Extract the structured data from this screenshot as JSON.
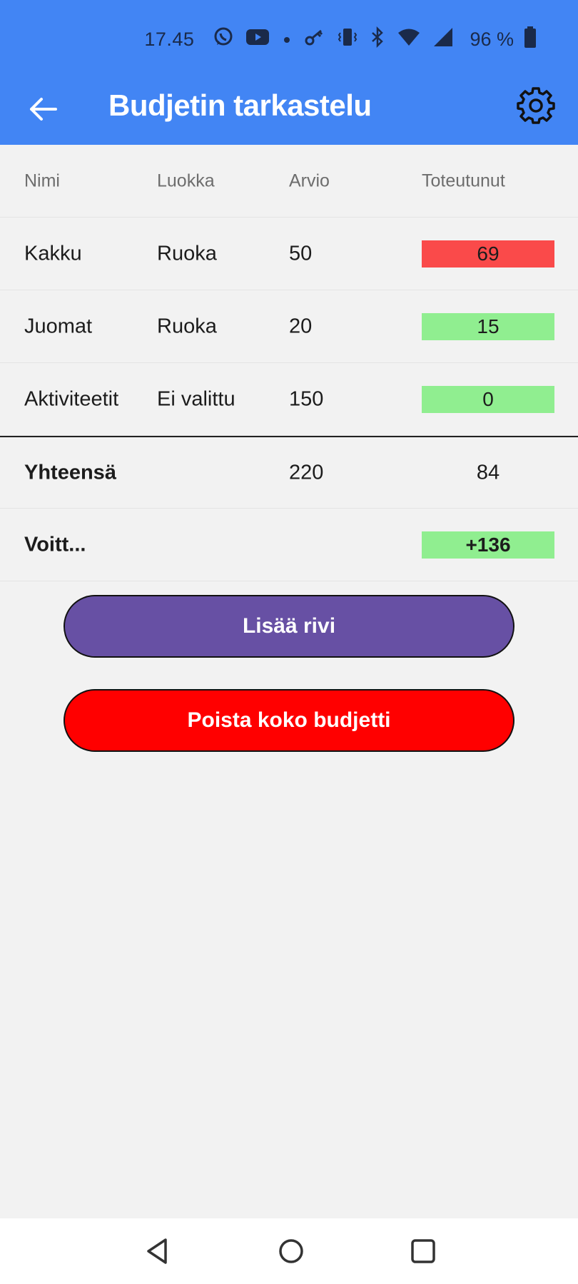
{
  "status_bar": {
    "time": "17.45",
    "battery": "96 %",
    "icons": [
      "whatsapp-icon",
      "youtube-icon",
      "dot-icon",
      "key-icon",
      "vibrate-icon",
      "bluetooth-icon",
      "wifi-icon",
      "signal-icon",
      "battery-icon"
    ]
  },
  "app_bar": {
    "title": "Budjetin tarkastelu",
    "back_icon": "arrow-left-icon",
    "settings_icon": "gear-icon"
  },
  "table": {
    "headers": [
      "Nimi",
      "Luokka",
      "Arvio",
      "Toteutunut"
    ],
    "rows": [
      {
        "name": "Kakku",
        "category": "Ruoka",
        "estimate": "50",
        "actual": "69",
        "status": "over"
      },
      {
        "name": "Juomat",
        "category": "Ruoka",
        "estimate": "20",
        "actual": "15",
        "status": "under"
      },
      {
        "name": "Aktiviteetit",
        "category": "Ei valittu",
        "estimate": "150",
        "actual": "0",
        "status": "under"
      }
    ],
    "total": {
      "label": "Yhteensä",
      "estimate": "220",
      "actual": "84"
    },
    "profit": {
      "label": "Voitt...",
      "value": "+136"
    }
  },
  "buttons": {
    "add_row": "Lisää rivi",
    "delete_budget": "Poista koko budjetti"
  },
  "colors": {
    "app_bar": "#4285f4",
    "over_budget": "#fa4a4a",
    "under_budget": "#90ee90",
    "add_button": "#6750a4",
    "delete_button": "#ff0000",
    "background": "#f2f2f2"
  },
  "nav_bar": {
    "icons": [
      "back-triangle-icon",
      "home-circle-icon",
      "recents-square-icon"
    ]
  }
}
